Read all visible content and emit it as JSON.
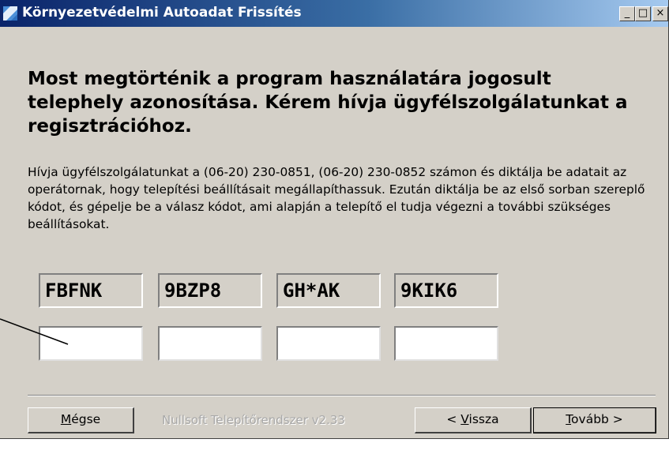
{
  "window": {
    "title": "Környezetvédelmi Autoadat Frissítés",
    "controls": {
      "minimize": "_",
      "maximize": "□",
      "close": "×"
    }
  },
  "main": {
    "heading": "Most megtörténik a program használatára jogosult telephely azonosítása. Kérem hívja ügyfélszolgálatunkat a regisztrációhoz.",
    "description": "Hívja ügyfélszolgálatunkat a (06-20) 230-0851, (06-20) 230-0852 számon és diktálja be adatait az operátornak, hogy telepítési beállításait megállapíthassuk. Ezután diktálja be az első sorban szereplő kódot, és gépelje be a válasz kódot, ami alapján a telepítő el tudja végezni a további szükséges beállításokat.",
    "codes": [
      "FBFNK",
      "9BZP8",
      "GH*AK",
      "9KIK6"
    ],
    "answers": [
      "",
      "",
      "",
      ""
    ]
  },
  "footer": {
    "cancel_label": "égse",
    "cancel_mnemonic": "M",
    "branding": "Nullsoft Telepítőrendszer v2.33",
    "back_prefix": "< ",
    "back_mnemonic": "V",
    "back_rest": "issza",
    "next_mnemonic": "T",
    "next_rest": "ovább >"
  },
  "colors": {
    "dialog_bg": "#d4d0c8",
    "titlebar_start": "#0a246a",
    "titlebar_end": "#a6caf0"
  }
}
